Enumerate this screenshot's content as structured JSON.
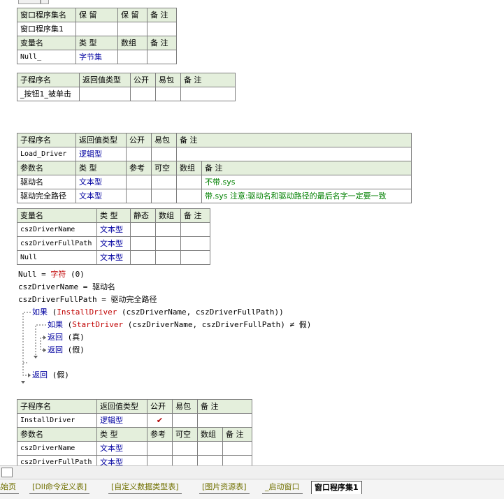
{
  "window_table": {
    "header1": [
      "窗口程序集名",
      "保 留",
      "保 留",
      "备 注"
    ],
    "row1": [
      "窗口程序集1",
      "",
      "",
      ""
    ],
    "header2": [
      "变量名",
      "类 型",
      "数组",
      "备 注"
    ],
    "row2": [
      "Null_",
      "字节集",
      "",
      ""
    ]
  },
  "sub1": {
    "header": [
      "子程序名",
      "返回值类型",
      "公开",
      "易包",
      "备 注"
    ],
    "row": [
      "_按钮1_被单击",
      "",
      "",
      "",
      ""
    ]
  },
  "load_driver": {
    "header": [
      "子程序名",
      "返回值类型",
      "公开",
      "易包",
      "备 注"
    ],
    "row": [
      "Load_Driver",
      "逻辑型",
      "",
      "",
      ""
    ],
    "param_header": [
      "参数名",
      "类 型",
      "参考",
      "可空",
      "数组",
      "备 注"
    ],
    "params": [
      [
        "驱动名",
        "文本型",
        "",
        "",
        "",
        "不带.sys"
      ],
      [
        "驱动完全路径",
        "文本型",
        "",
        "",
        "",
        "带.sys 注意:驱动名和驱动路径的最后名字一定要一致"
      ]
    ]
  },
  "locals": {
    "header": [
      "变量名",
      "类 型",
      "静态",
      "数组",
      "备 注"
    ],
    "rows": [
      [
        "cszDriverName",
        "文本型",
        "",
        "",
        ""
      ],
      [
        "cszDriverFullPath",
        "文本型",
        "",
        "",
        ""
      ],
      [
        "Null",
        "文本型",
        "",
        "",
        ""
      ]
    ]
  },
  "code": {
    "line1": {
      "a": "Null = ",
      "b": "字符",
      "c": " (0)"
    },
    "line2": "cszDriverName = 驱动名",
    "line3": "cszDriverFullPath = 驱动完全路径",
    "line4": {
      "a": "如果",
      "b": " (",
      "c": "InstallDriver",
      "d": " (cszDriverName, cszDriverFullPath))"
    },
    "line5": {
      "a": "如果",
      "b": " (",
      "c": "StartDriver",
      "d": " (cszDriverName, cszDriverFullPath) ≠ 假)"
    },
    "line6": {
      "a": "返回",
      "b": " (真)"
    },
    "line7": {
      "a": "返回",
      "b": " (假)"
    },
    "line8": {
      "a": "返回",
      "b": " (假)"
    }
  },
  "install_driver": {
    "header": [
      "子程序名",
      "返回值类型",
      "公开",
      "易包",
      "备 注"
    ],
    "row": [
      "InstallDriver",
      "逻辑型",
      "✔",
      "",
      ""
    ],
    "param_header": [
      "参数名",
      "类 型",
      "参考",
      "可空",
      "数组",
      "备 注"
    ],
    "params": [
      [
        "cszDriverName",
        "文本型",
        "",
        "",
        "",
        ""
      ],
      [
        "cszDriverFullPath",
        "文本型",
        "",
        "",
        "",
        ""
      ]
    ]
  },
  "tabs": [
    "起始页",
    "[Dll命令定义表]",
    "[自定义数据类型表]",
    "[图片资源表]",
    "_启动窗口",
    "窗口程序集1"
  ]
}
